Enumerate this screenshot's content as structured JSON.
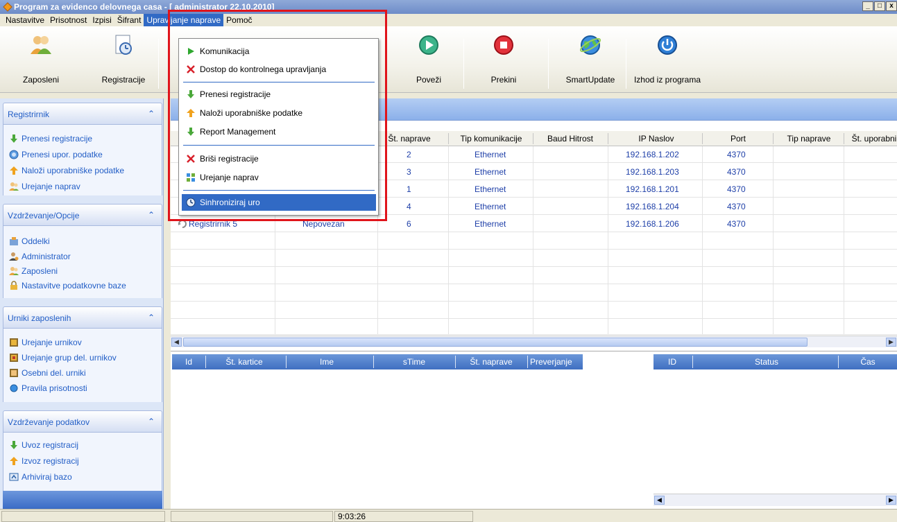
{
  "window": {
    "title": "Program za evidenco delovnega casa - [ administrator 22.10.2010]",
    "controls": [
      "_",
      "□",
      "x"
    ]
  },
  "menubar": {
    "items": [
      "Nastavitve",
      "Prisotnost",
      "Izpisi",
      "Šifrant",
      "Upravljanje naprave",
      "Pomoč"
    ],
    "active_index": 4
  },
  "toolbar": {
    "buttons": [
      {
        "label": "Zaposleni",
        "icon": "employees-icon"
      },
      {
        "label": "Registracije",
        "icon": "clock-document-icon"
      },
      {
        "label": "Poveži",
        "icon": "play-icon"
      },
      {
        "label": "Prekini",
        "icon": "stop-icon"
      },
      {
        "label": "SmartUpdate",
        "icon": "globe-icon"
      },
      {
        "label": "Izhod iz programa",
        "icon": "power-icon"
      }
    ]
  },
  "sidebar": {
    "groups": [
      {
        "title": "Registrirnik",
        "items": [
          {
            "label": "Prenesi registracije",
            "icon": "green-down-arrow-icon"
          },
          {
            "label": "Prenesi upor. podatke",
            "icon": "blue-circle-icon"
          },
          {
            "label": "Naloži uporabniške podatke",
            "icon": "orange-up-arrow-icon"
          },
          {
            "label": "Urejanje naprav",
            "icon": "users-icon"
          }
        ]
      },
      {
        "title": "Vzdrževanje/Opcije",
        "items": [
          {
            "label": "Oddelki",
            "icon": "departments-icon"
          },
          {
            "label": "Administrator",
            "icon": "admin-icon"
          },
          {
            "label": "Zaposleni",
            "icon": "employees-icon"
          },
          {
            "label": "Nastavitve podatkovne baze",
            "icon": "database-lock-icon"
          }
        ]
      },
      {
        "title": "Urniki zaposlenih",
        "items": [
          {
            "label": "Urejanje urnikov",
            "icon": "schedule-icon"
          },
          {
            "label": "Urejanje grup del. urnikov",
            "icon": "schedule-group-icon"
          },
          {
            "label": "Osebni del. urniki",
            "icon": "personal-schedule-icon"
          },
          {
            "label": "Pravila prisotnosti",
            "icon": "blue-dot-icon"
          }
        ]
      },
      {
        "title": "Vzdrževanje podatkov",
        "items": [
          {
            "label": "Uvoz registracij",
            "icon": "green-down-arrow-icon"
          },
          {
            "label": "Izvoz registracij",
            "icon": "orange-up-arrow-icon"
          },
          {
            "label": "Arhiviraj bazo",
            "icon": "archive-icon"
          }
        ]
      }
    ]
  },
  "grid": {
    "columns": [
      "Št. naprave",
      "Tip komunikacije",
      "Baud Hitrost",
      "IP Naslov",
      "Port",
      "Tip naprave",
      "Št. uporabni"
    ],
    "rows": [
      {
        "num": "2",
        "comm": "Ethernet",
        "baud": "",
        "ip": "192.168.1.202",
        "port": "4370"
      },
      {
        "num": "3",
        "comm": "Ethernet",
        "baud": "",
        "ip": "192.168.1.203",
        "port": "4370"
      },
      {
        "num": "1",
        "comm": "Ethernet",
        "baud": "",
        "ip": "192.168.1.201",
        "port": "4370"
      },
      {
        "num": "4",
        "comm": "Ethernet",
        "baud": "",
        "ip": "192.168.1.204",
        "port": "4370"
      },
      {
        "name": "Registrirnik 5",
        "status": "Nepovezan",
        "num": "6",
        "comm": "Ethernet",
        "baud": "",
        "ip": "192.168.1.206",
        "port": "4370"
      }
    ]
  },
  "bottom_left": {
    "columns": [
      "Id",
      "Št. kartice",
      "Ime",
      "sTime",
      "Št. naprave",
      "Preverjanje"
    ]
  },
  "bottom_right": {
    "columns": [
      "ID",
      "Status",
      "Čas"
    ]
  },
  "statusbar": {
    "time": "9:03:26"
  },
  "dropdown": {
    "items": [
      {
        "label": "Komunikacija",
        "icon": "green-play-icon"
      },
      {
        "label": "Dostop do kontrolnega upravljanja",
        "icon": "red-x-icon"
      },
      {
        "label": "Prenesi registracije",
        "icon": "green-down-arrow-icon"
      },
      {
        "label": "Naloži uporabniške podatke",
        "icon": "orange-up-arrow-icon"
      },
      {
        "label": "Report Management",
        "icon": "green-down-arrow-icon"
      },
      {
        "label": "Briši registracije",
        "icon": "red-x-icon"
      },
      {
        "label": "Urejanje naprav",
        "icon": "devices-icon"
      },
      {
        "label": "Sinhroniziraj uro",
        "icon": "clock-icon"
      }
    ],
    "selected_index": 7
  },
  "colors": {
    "accent": "#316ac5",
    "highlight_box": "#e0141b",
    "link_blue": "#215dc6"
  }
}
